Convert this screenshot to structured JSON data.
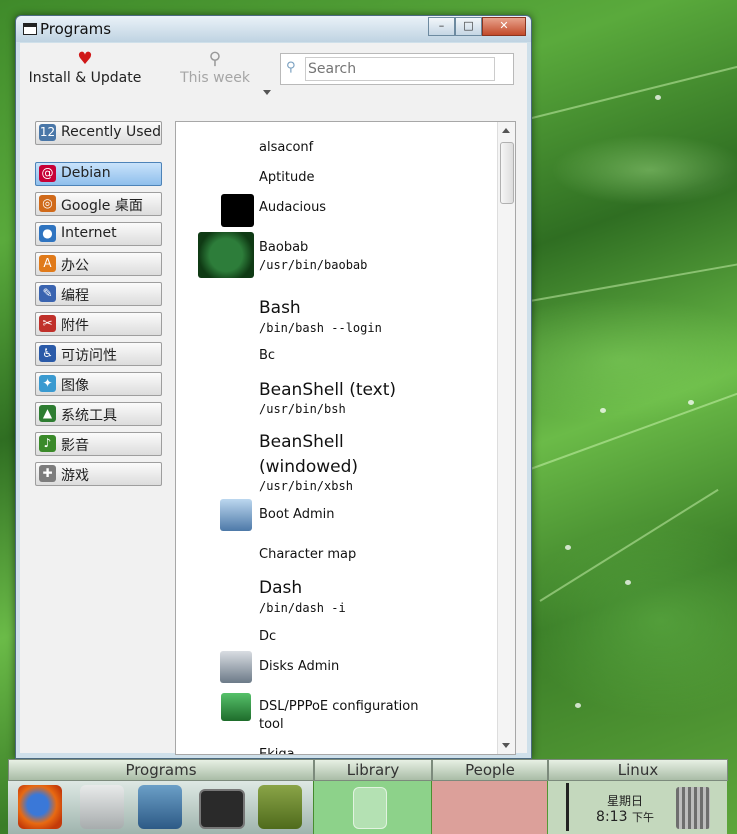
{
  "window": {
    "title": "Programs",
    "buttons": {
      "minimize": "–",
      "maximize": "□",
      "close": "✕"
    }
  },
  "toolbar": {
    "install_label": "Install & Update",
    "week_label": "This week",
    "search_placeholder": "Search"
  },
  "categories": [
    {
      "label": "Recently Used",
      "icon": "calendar-icon",
      "color": "#4a77a8",
      "glyph": "12"
    },
    {
      "label": "Debian",
      "icon": "debian-swirl-icon",
      "color": "#c70036",
      "glyph": "@",
      "selected": true
    },
    {
      "label": "Google 桌面",
      "icon": "google-desktop-icon",
      "color": "#d06a1a",
      "glyph": "◎"
    },
    {
      "label": "Internet",
      "icon": "globe-icon",
      "color": "#2f74c0",
      "glyph": "●"
    },
    {
      "label": "办公",
      "icon": "office-icon",
      "color": "#e07a1a",
      "glyph": "A"
    },
    {
      "label": "编程",
      "icon": "programming-icon",
      "color": "#3a64b0",
      "glyph": "✎"
    },
    {
      "label": "附件",
      "icon": "accessories-icon",
      "color": "#c0302a",
      "glyph": "✂"
    },
    {
      "label": "可访问性",
      "icon": "accessibility-icon",
      "color": "#2a5aa8",
      "glyph": "♿"
    },
    {
      "label": "图像",
      "icon": "graphics-icon",
      "color": "#3a9ad0",
      "glyph": "✦"
    },
    {
      "label": "系统工具",
      "icon": "system-tools-icon",
      "color": "#2e7d32",
      "glyph": "▲"
    },
    {
      "label": "影音",
      "icon": "multimedia-icon",
      "color": "#3a8a2a",
      "glyph": "♪"
    },
    {
      "label": "游戏",
      "icon": "games-icon",
      "color": "#7d7d7d",
      "glyph": "✚"
    }
  ],
  "apps": [
    {
      "name": "alsaconf"
    },
    {
      "name": "Aptitude"
    },
    {
      "name": "Audacious",
      "icon": "audacious-icon"
    },
    {
      "name": "Baobab",
      "cmd": "/usr/bin/baobab",
      "icon": "baobab-icon"
    },
    {
      "name": "Bash",
      "cmd": "/bin/bash --login"
    },
    {
      "name": "Bc"
    },
    {
      "name": "BeanShell (text)",
      "cmd": "/usr/bin/bsh"
    },
    {
      "name": "BeanShell",
      "name2": "(windowed)",
      "cmd": "/usr/bin/xbsh"
    },
    {
      "name": "Boot Admin",
      "icon": "boot-admin-icon"
    },
    {
      "name": "Character map"
    },
    {
      "name": "Dash",
      "cmd": "/bin/dash -i"
    },
    {
      "name": "Dc"
    },
    {
      "name": "Disks Admin",
      "icon": "disks-admin-icon"
    },
    {
      "name": "DSL/PPPoE configuration",
      "name2": "tool",
      "icon": "dsl-phone-icon"
    },
    {
      "name": "Ekiga"
    }
  ],
  "taskbar": {
    "tabs": [
      "Programs",
      "Library",
      "People",
      "Linux"
    ],
    "clock": {
      "day": "星期日",
      "time": "8:13",
      "ampm": "下午"
    },
    "launchers": [
      "firefox-icon",
      "file-cabinet-icon",
      "image-folder-icon",
      "window-icon",
      "books-icon"
    ]
  },
  "colors": {
    "library_panel": "#8dd28a",
    "people_panel": "#dca09a",
    "linux_panel": "#c4d8bd"
  }
}
